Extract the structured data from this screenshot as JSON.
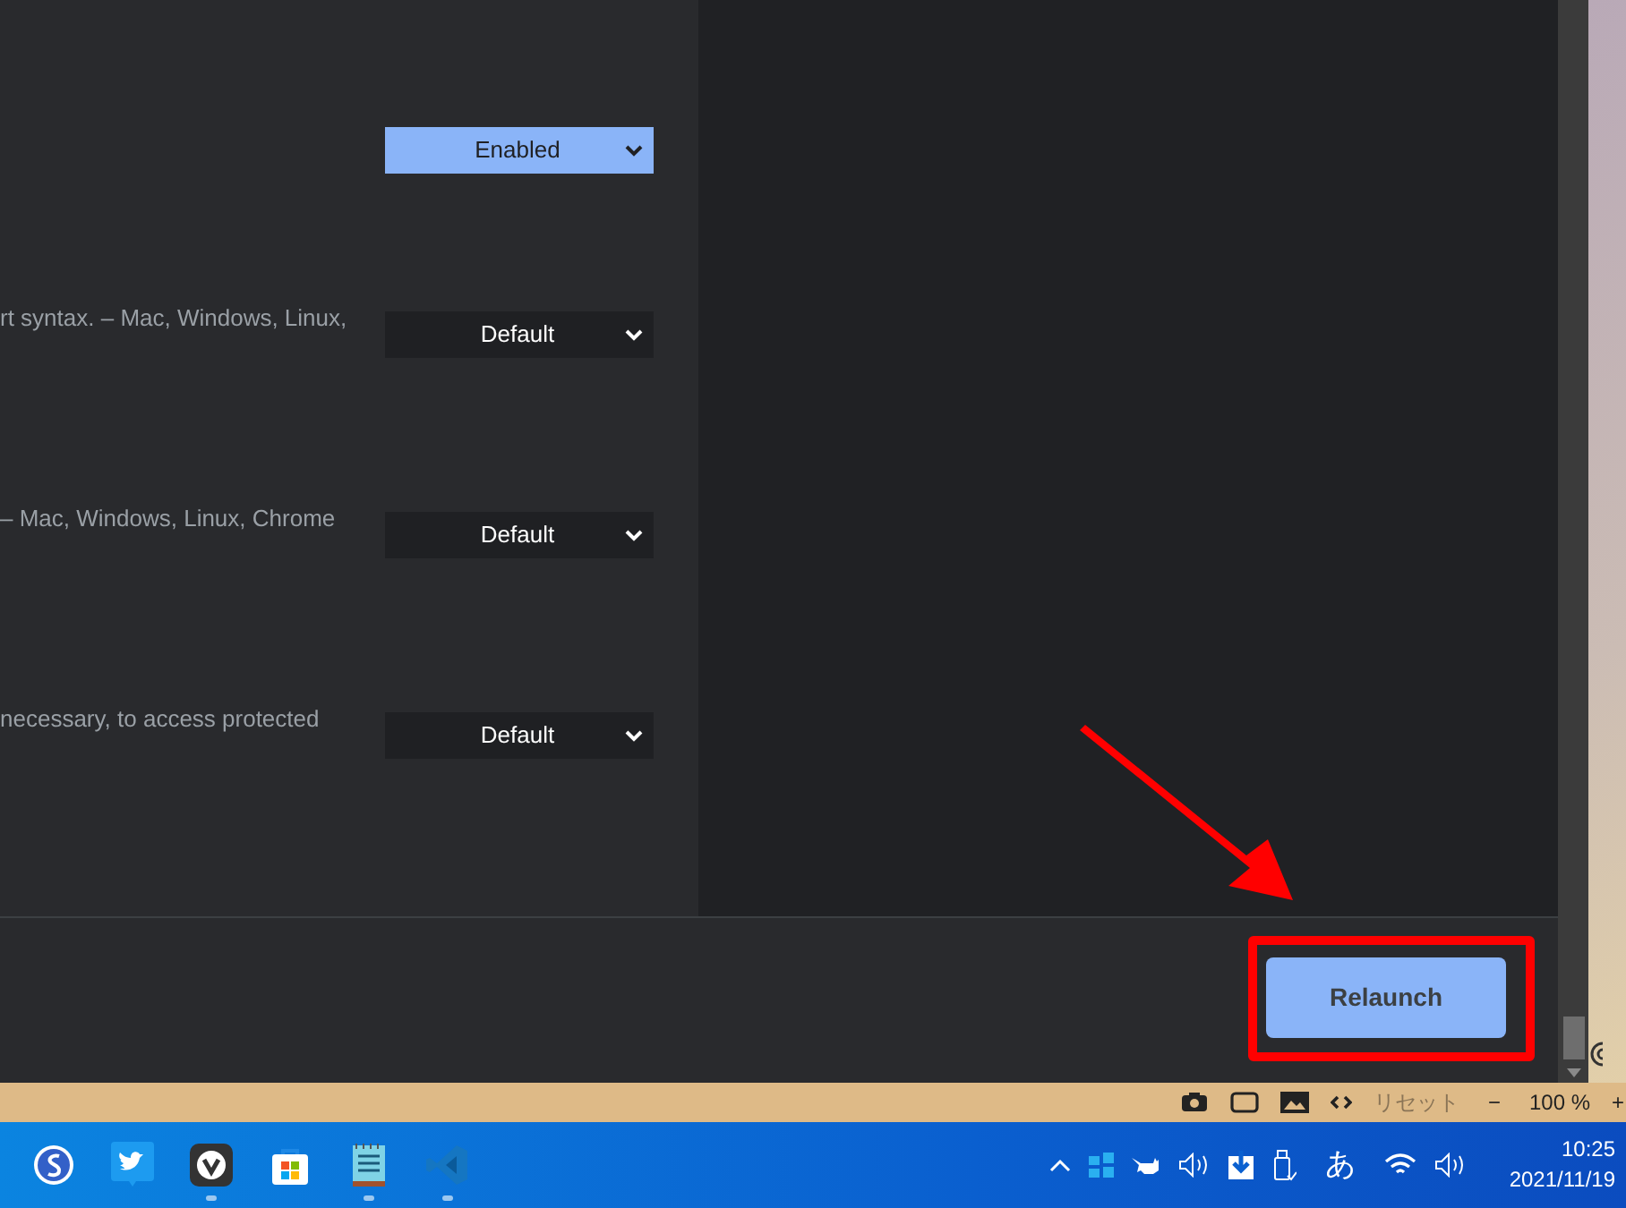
{
  "flags": [
    {
      "value": "Enabled",
      "highlighted": true
    },
    {
      "description": "rt syntax. – Mac, Windows, Linux,",
      "value": "Default",
      "highlighted": false
    },
    {
      "description": "– Mac, Windows, Linux, Chrome",
      "value": "Default",
      "highlighted": false
    },
    {
      "description": "necessary, to access protected",
      "value": "Default",
      "highlighted": false
    }
  ],
  "relaunch_button": "Relaunch",
  "status_bar": {
    "reset": "リセット",
    "zoom_out": "−",
    "zoom": "100 %",
    "zoom_in": "+"
  },
  "taskbar": {
    "apps": [
      {
        "kind": "simplenote",
        "running": false
      },
      {
        "kind": "twitter",
        "running": false
      },
      {
        "kind": "vivaldi",
        "running": true
      },
      {
        "kind": "store",
        "running": false
      },
      {
        "kind": "notepad",
        "running": true
      },
      {
        "kind": "vscode",
        "running": true
      }
    ],
    "ime": "あ",
    "time": "10:25",
    "date": "2021/11/19"
  }
}
